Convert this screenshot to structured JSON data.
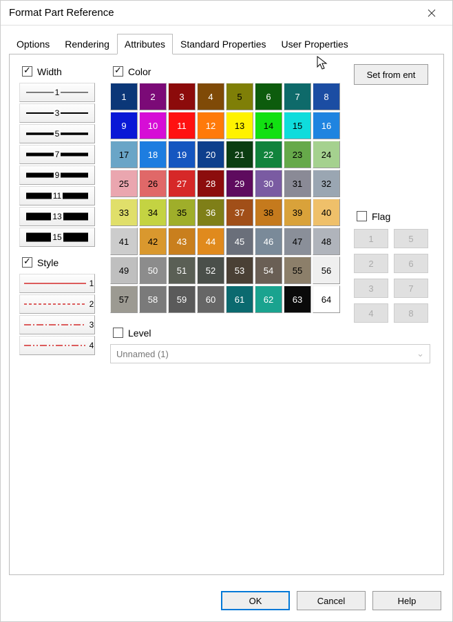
{
  "title": "Format Part Reference",
  "tabs": [
    "Options",
    "Rendering",
    "Attributes",
    "Standard Properties",
    "User Properties"
  ],
  "active_tab": 2,
  "width": {
    "label": "Width",
    "checked": true,
    "items": [
      "1",
      "3",
      "5",
      "7",
      "9",
      "11",
      "13",
      "15"
    ],
    "thickness": [
      1,
      2,
      3.5,
      5,
      7,
      9,
      11,
      13
    ]
  },
  "style": {
    "label": "Style",
    "checked": true,
    "items": [
      "1",
      "2",
      "3",
      "4"
    ]
  },
  "color": {
    "label": "Color",
    "checked": true,
    "swatches": [
      {
        "n": "1",
        "bg": "#0b3778",
        "fg": "#fff"
      },
      {
        "n": "2",
        "bg": "#7b0a77",
        "fg": "#fff"
      },
      {
        "n": "3",
        "bg": "#8c0b0b",
        "fg": "#fff"
      },
      {
        "n": "4",
        "bg": "#7f4a07",
        "fg": "#fff"
      },
      {
        "n": "5",
        "bg": "#7f7f07",
        "fg": "#000"
      },
      {
        "n": "6",
        "bg": "#0d5c0d",
        "fg": "#fff"
      },
      {
        "n": "7",
        "bg": "#0e6a6a",
        "fg": "#fff"
      },
      {
        "n": "8",
        "bg": "#1b4da3",
        "fg": "#fff"
      },
      {
        "n": "9",
        "bg": "#0a18d6",
        "fg": "#fff"
      },
      {
        "n": "10",
        "bg": "#d60dd6",
        "fg": "#fff"
      },
      {
        "n": "11",
        "bg": "#ff1111",
        "fg": "#fff"
      },
      {
        "n": "12",
        "bg": "#ff7a0a",
        "fg": "#fff"
      },
      {
        "n": "13",
        "bg": "#fff200",
        "fg": "#000"
      },
      {
        "n": "14",
        "bg": "#12e012",
        "fg": "#000"
      },
      {
        "n": "15",
        "bg": "#0fdcdc",
        "fg": "#000"
      },
      {
        "n": "16",
        "bg": "#1f84e0",
        "fg": "#fff"
      },
      {
        "n": "17",
        "bg": "#6aa5c7",
        "fg": "#000"
      },
      {
        "n": "18",
        "bg": "#1d7de0",
        "fg": "#fff"
      },
      {
        "n": "19",
        "bg": "#1556c0",
        "fg": "#fff"
      },
      {
        "n": "20",
        "bg": "#0e3f8c",
        "fg": "#fff"
      },
      {
        "n": "21",
        "bg": "#0b3d11",
        "fg": "#fff"
      },
      {
        "n": "22",
        "bg": "#11833c",
        "fg": "#fff"
      },
      {
        "n": "23",
        "bg": "#66a94a",
        "fg": "#000"
      },
      {
        "n": "24",
        "bg": "#a5d18f",
        "fg": "#000"
      },
      {
        "n": "25",
        "bg": "#eaa6af",
        "fg": "#000"
      },
      {
        "n": "26",
        "bg": "#e06868",
        "fg": "#000"
      },
      {
        "n": "27",
        "bg": "#d62828",
        "fg": "#fff"
      },
      {
        "n": "28",
        "bg": "#8c0d0d",
        "fg": "#fff"
      },
      {
        "n": "29",
        "bg": "#5e0b5e",
        "fg": "#fff"
      },
      {
        "n": "30",
        "bg": "#7a5ba2",
        "fg": "#fff"
      },
      {
        "n": "31",
        "bg": "#8a8a96",
        "fg": "#000"
      },
      {
        "n": "32",
        "bg": "#9aa6b2",
        "fg": "#000"
      },
      {
        "n": "33",
        "bg": "#e0df6a",
        "fg": "#000"
      },
      {
        "n": "34",
        "bg": "#c4d342",
        "fg": "#000"
      },
      {
        "n": "35",
        "bg": "#9fae2a",
        "fg": "#000"
      },
      {
        "n": "36",
        "bg": "#7f7f18",
        "fg": "#fff"
      },
      {
        "n": "37",
        "bg": "#a14f18",
        "fg": "#fff"
      },
      {
        "n": "38",
        "bg": "#c57a1d",
        "fg": "#000"
      },
      {
        "n": "39",
        "bg": "#d9a23a",
        "fg": "#000"
      },
      {
        "n": "40",
        "bg": "#efc06a",
        "fg": "#000"
      },
      {
        "n": "41",
        "bg": "#cccccc",
        "fg": "#000"
      },
      {
        "n": "42",
        "bg": "#d9982e",
        "fg": "#000"
      },
      {
        "n": "43",
        "bg": "#c97f1d",
        "fg": "#fff"
      },
      {
        "n": "44",
        "bg": "#e08a1d",
        "fg": "#fff"
      },
      {
        "n": "45",
        "bg": "#6a6f7a",
        "fg": "#fff"
      },
      {
        "n": "46",
        "bg": "#7a8a99",
        "fg": "#fff"
      },
      {
        "n": "47",
        "bg": "#8a8f99",
        "fg": "#000"
      },
      {
        "n": "48",
        "bg": "#b0b4bb",
        "fg": "#000"
      },
      {
        "n": "49",
        "bg": "#bfbfbf",
        "fg": "#000"
      },
      {
        "n": "50",
        "bg": "#8c8c8c",
        "fg": "#fff"
      },
      {
        "n": "51",
        "bg": "#5a5f55",
        "fg": "#fff"
      },
      {
        "n": "52",
        "bg": "#4a4f4a",
        "fg": "#fff"
      },
      {
        "n": "53",
        "bg": "#4a4035",
        "fg": "#fff"
      },
      {
        "n": "54",
        "bg": "#6a5f55",
        "fg": "#fff"
      },
      {
        "n": "55",
        "bg": "#8c7f6a",
        "fg": "#000"
      },
      {
        "n": "56",
        "bg": "#efefef",
        "fg": "#000"
      },
      {
        "n": "57",
        "bg": "#9c9a92",
        "fg": "#000"
      },
      {
        "n": "58",
        "bg": "#7a7a7a",
        "fg": "#fff"
      },
      {
        "n": "59",
        "bg": "#5a5a5a",
        "fg": "#fff"
      },
      {
        "n": "60",
        "bg": "#666666",
        "fg": "#fff"
      },
      {
        "n": "61",
        "bg": "#0b6a6f",
        "fg": "#fff"
      },
      {
        "n": "62",
        "bg": "#1aa38f",
        "fg": "#fff"
      },
      {
        "n": "63",
        "bg": "#0a0a0a",
        "fg": "#fff"
      },
      {
        "n": "64",
        "bg": "#ffffff",
        "fg": "#000"
      }
    ]
  },
  "set_from_ent": "Set from ent",
  "flag": {
    "label": "Flag",
    "checked": false,
    "items": [
      "1",
      "5",
      "2",
      "6",
      "3",
      "7",
      "4",
      "8"
    ]
  },
  "level": {
    "label": "Level",
    "checked": false,
    "value": "Unnamed (1)"
  },
  "buttons": {
    "ok": "OK",
    "cancel": "Cancel",
    "help": "Help"
  }
}
